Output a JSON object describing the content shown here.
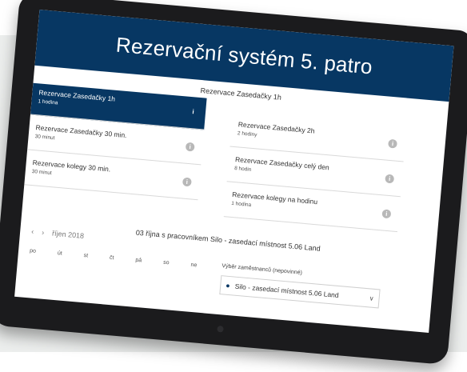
{
  "app": {
    "title": "Rezervační systém 5. patro"
  },
  "services": {
    "heading": "Rezervace Zasedačky 1h",
    "left": [
      {
        "title": "Rezervace Zasedačky 1h",
        "duration": "1 hodina",
        "selected": true
      },
      {
        "title": "Rezervace Zasedačky 30 min.",
        "duration": "30 minut",
        "selected": false
      },
      {
        "title": "Rezervace kolegy 30 min.",
        "duration": "30 minut",
        "selected": false
      }
    ],
    "right": [
      {
        "title": "Rezervace Zasedačky 2h",
        "duration": "2 hodiny"
      },
      {
        "title": "Rezervace Zasedačky celý den",
        "duration": "8 hodin"
      },
      {
        "title": "Rezervace kolegy na hodinu",
        "duration": "1 hodina"
      }
    ]
  },
  "booking": {
    "summary": "03 října s pracovníkem Silo - zasedací místnost 5.06 Land"
  },
  "calendar": {
    "prev": "‹",
    "next": "›",
    "month": "říjen 2018",
    "weekdays": [
      "po",
      "út",
      "st",
      "čt",
      "pá",
      "so",
      "ne"
    ]
  },
  "employee": {
    "label": "Výběr zaměstnanců (nepovinné)",
    "selected": "Silo - zasedací místnost 5.06 Land"
  },
  "colors": {
    "accent": "#073763",
    "band": "#eceeed",
    "device": "#1b1b1d"
  }
}
